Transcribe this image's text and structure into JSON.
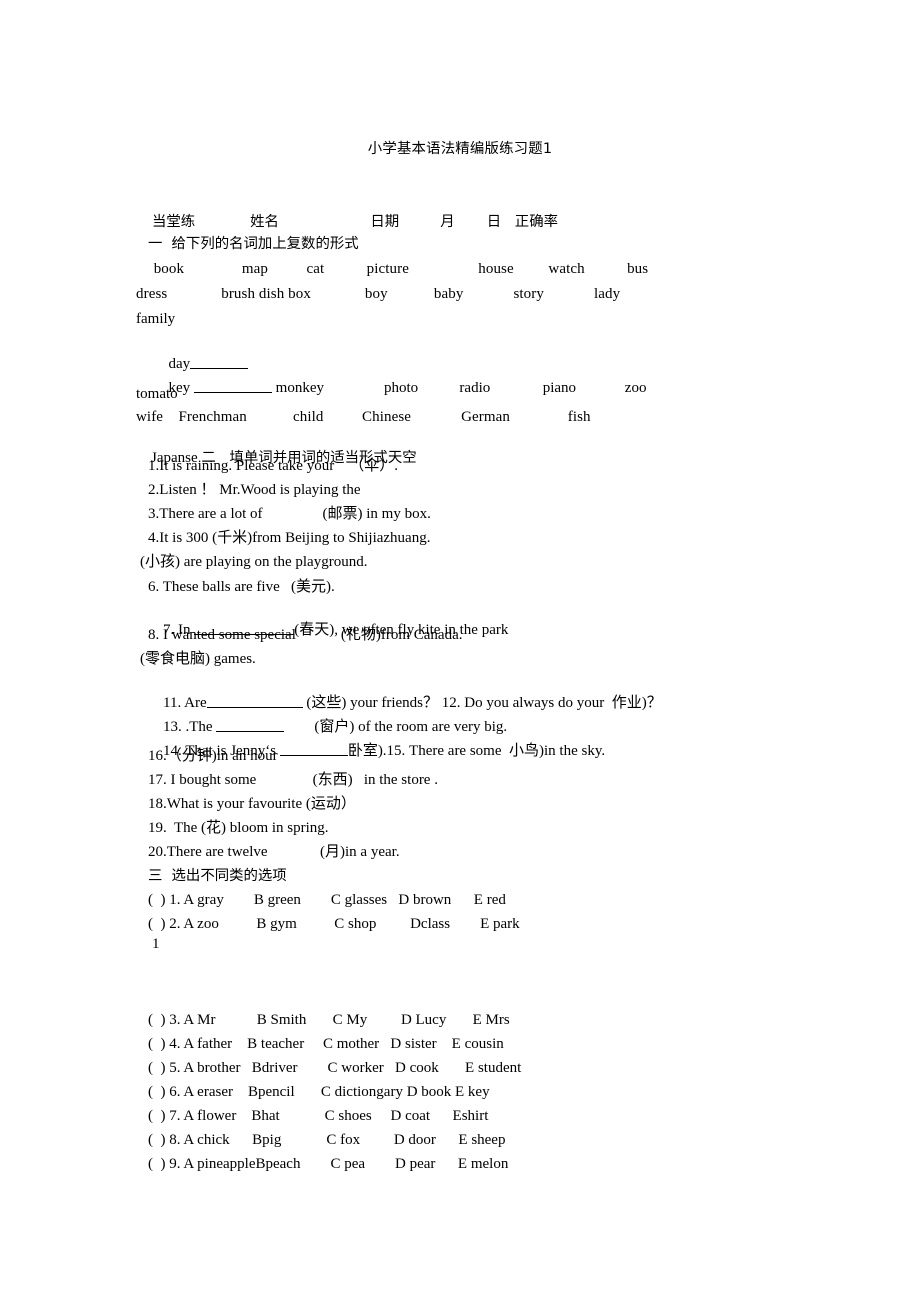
{
  "document": {
    "title": "小学基本语法精编版练习题1",
    "page_number": "1"
  },
  "header": {
    "line": "当堂练            姓名                    日期         月       日   正确率"
  },
  "sections": [
    {
      "id": "section-one",
      "heading": "一  给下列的名词加上复数的形式",
      "word_rows": [
        "  book              map         cat           picture                 house        watch          bus",
        "dress             brush dish box             boy           baby            story            lady",
        "family",
        "  day",
        "  key                  monkey              photo        radio             piano            zoo",
        "tomato",
        "wife    Frenchman           child         Chinese           German              fish",
        "Japanse"
      ],
      "word_rows_plain": {
        "row1": [
          "book",
          "map",
          "cat",
          "picture",
          "house",
          "watch",
          "bus"
        ],
        "row2": [
          "dress",
          "brush dish box",
          "boy",
          "baby",
          "story",
          "lady"
        ],
        "row3": [
          "family"
        ],
        "row4": [
          "day"
        ],
        "row5": [
          "key",
          "monkey",
          "photo",
          "radio",
          "piano",
          "zoo"
        ],
        "row6": [
          "tomato"
        ],
        "row7": [
          "wife",
          "Frenchman",
          "child",
          "Chinese",
          "German",
          "fish"
        ],
        "row8": [
          "Japanse"
        ]
      }
    },
    {
      "id": "section-two",
      "heading": "二   填单词并用词的适当形式天空",
      "items": [
        "1.It is raining. Please take your     （伞）.",
        "2.Listen ！ Mr.Wood is playing the",
        "3.There are a lot of                (邮票) in my box.",
        "4.It is 300 (千米)from Beijing to Shijiazhuang.",
        "(小孩) are playing on the playground.",
        "6. These balls are five   (美元).",
        "7. In ____________(春天), we often fly kite in the park",
        "8. I wanted some special            (礼物)from Canada.",
        "(零食电脑) games.",
        "11. Are_________ (这些) your friends？ 12. Do you always do your  作业)？",
        "13. .The _______        (窗户) of the room are very big.",
        "14. That is Jenny‘s _______卧室).15. There are some  小鸟)in the sky.",
        "16.（分钟)in an hour",
        "17. I bought some               (东西)   in the store .",
        "18.What is your favourite (运动）",
        "19.  The (花) bloom in spring.",
        "20.There are twelve              (月)in a year."
      ]
    },
    {
      "id": "section-three",
      "heading": "三  选出不同类的选项",
      "questions": [
        {
          "mark": "(    )",
          "num": "1.",
          "options": [
            "A gray",
            "B green",
            "C glasses",
            "D brown",
            "E red"
          ]
        },
        {
          "mark": "(    )",
          "num": "2.",
          "options": [
            "A zoo",
            "B gym",
            "C shop",
            "Dclass",
            "E park"
          ]
        },
        {
          "mark": "(    )",
          "num": "3.",
          "options": [
            "A Mr",
            "B Smith",
            "C My",
            "D Lucy",
            "E Mrs"
          ]
        },
        {
          "mark": "(    )",
          "num": "4.",
          "options": [
            "A father",
            "B teacher",
            "C mother",
            "D sister",
            "E cousin"
          ]
        },
        {
          "mark": "(    )",
          "num": "5.",
          "options": [
            "A brother",
            "Bdriver",
            "C worker",
            "D cook",
            "E student"
          ]
        },
        {
          "mark": "(    )",
          "num": "6.",
          "options": [
            "A eraser",
            "Bpencil",
            "C dictiongary",
            "D book",
            "E key"
          ]
        },
        {
          "mark": "(    )",
          "num": "7.",
          "options": [
            "A flower",
            "Bhat",
            "C shoes",
            "D coat",
            "Eshirt"
          ]
        },
        {
          "mark": "(    )",
          "num": "8.",
          "options": [
            "A chick",
            "Bpig",
            "C fox",
            "D door",
            "E sheep"
          ]
        },
        {
          "mark": "(    )",
          "num": "9.",
          "options": [
            "A pineapple",
            "Bpeach",
            "C pea",
            "D pear",
            "E melon"
          ]
        }
      ]
    }
  ],
  "lines": {
    "l_header": "当堂练            姓名                    日期         月       日   正确率",
    "l_sec1_head": "一  给下列的名词加上复数的形式",
    "l_words1": "  book               map          cat           picture                  house         watch           bus",
    "l_words2": "dress              brush dish box              boy            baby             story             lady",
    "l_words3": "family",
    "l_day": "  day",
    "l_key_a": "  key",
    "l_key_b": "monkey                photo           radio              piano             zoo",
    "l_tomato": "tomato",
    "l_wife": "wife    Frenchman            child          Chinese             German               fish",
    "l_japanse_a": "Japanse ",
    "l_japanse_b": "二   填单词并用词的适当形式天空",
    "l_i1": "1.It is raining. Please take your    （伞）.",
    "l_i2": "2.Listen ！ Mr.Wood is playing the",
    "l_i3": "3.There are a lot of                (邮票) in my box.",
    "l_i4": "4.It is 300 (千米)from Beijing to Shijiazhuang.",
    "l_i5": "(小孩) are playing on the playground.",
    "l_i6": "6. These balls are five   (美元).",
    "l_i7a": "7. In ",
    "l_i7b": "(春天), we often fly kite in the park",
    "l_i8": "8. I wanted some special            (礼物)from Canada.",
    "l_i10": "(零食电脑) games.",
    "l_i11a": "11. Are",
    "l_i11b": " (这些) your friends？ 12. Do you always do your  作业)？",
    "l_i13a": "13. .The ",
    "l_i13b": "        (窗户) of the room are very big.",
    "l_i14a": "14. That is Jenny‘s ",
    "l_i14b": "卧室).15. There are some  小鸟)in the sky.",
    "l_i16": "16.（分钟)in an hour",
    "l_i17": "17. I bought some               (东西)   in the store .",
    "l_i18": "18.What is your favourite (运动）",
    "l_i19": "19.  The (花) bloom in spring.",
    "l_i20": "20.There are twelve              (月)in a year.",
    "l_sec3_head": "三  选出不同类的选项",
    "l_q1": "(  ) 1. A gray        B green        C glasses   D brown      E red",
    "l_q2": "(  ) 2. A zoo          B gym          C shop         Dclass        E park",
    "l_q3": "(  ) 3. A Mr           B Smith       C My         D Lucy       E Mrs",
    "l_q4": "(  ) 4. A father    B teacher     C mother   D sister    E cousin",
    "l_q5": "(  ) 5. A brother   Bdriver        C worker   D cook       E student",
    "l_q6": "(  ) 6. A eraser    Bpencil       C dictiongary D book E key",
    "l_q7": "(  ) 7. A flower    Bhat            C shoes     D coat      Eshirt",
    "l_q8": "(  ) 8. A chick      Bpig            C fox         D door      E sheep",
    "l_q9": "(  ) 9. A pineappleBpeach        C pea        D pear      E melon",
    "l_pagenum": "1"
  }
}
